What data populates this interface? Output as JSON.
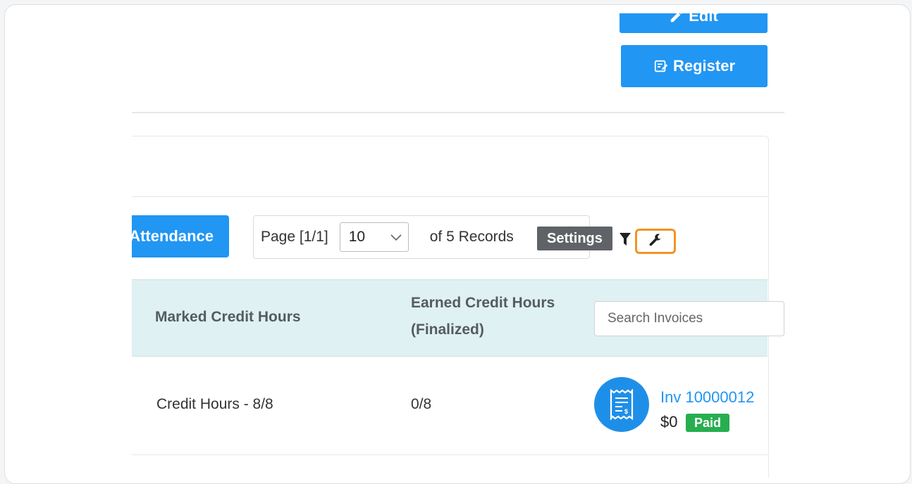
{
  "header": {
    "edit_label": "Edit",
    "register_label": "Register"
  },
  "toolbar": {
    "attendance_label": "Attendance",
    "page_label": "Page [1/1]",
    "page_size_value": "10",
    "records_label": "of 5 Records",
    "settings_tooltip": "Settings"
  },
  "table": {
    "columns": {
      "marked_credit_hours": "Marked Credit Hours",
      "earned_credit_hours": "Earned Credit Hours (Finalized)"
    },
    "search_placeholder": "Search Invoices",
    "rows": [
      {
        "marked_credit_hours": "Credit Hours - 8/8",
        "earned_credit_hours": "0/8",
        "invoice_label": "Inv 10000012",
        "invoice_amount": "$0",
        "invoice_status": "Paid"
      }
    ]
  },
  "colors": {
    "primary": "#2196f3",
    "header_bg": "#dff1f2",
    "highlight": "#f29423",
    "paid": "#27ae4f",
    "tooltip": "#5f6368"
  },
  "icons": [
    "edit-icon",
    "register-icon",
    "chevron-down-icon",
    "filter-icon",
    "wrench-icon",
    "invoice-receipt-icon"
  ]
}
